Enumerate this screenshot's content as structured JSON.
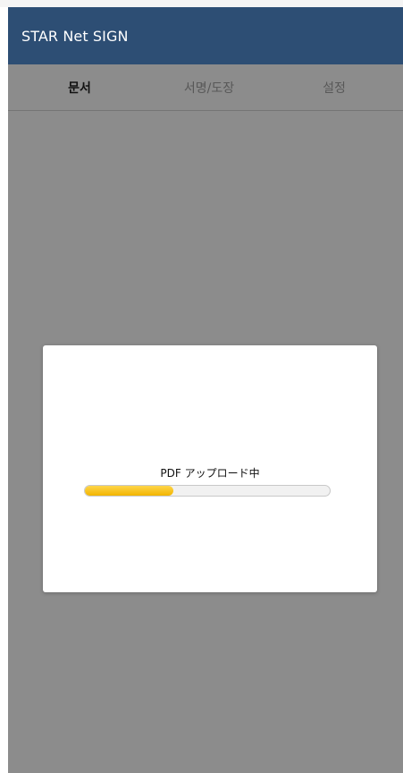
{
  "app": {
    "title": "STAR Net SIGN"
  },
  "tabs": [
    {
      "label": "문서",
      "active": true
    },
    {
      "label": "서명/도장",
      "active": false
    },
    {
      "label": "설정",
      "active": false
    }
  ],
  "dialog": {
    "message": "PDF アップロード中",
    "progress": 0.36
  },
  "colors": {
    "header_bg": "#2d4e74",
    "progress_fill": "#f5bf12",
    "overlay": "rgba(0,0,0,0.45)"
  }
}
